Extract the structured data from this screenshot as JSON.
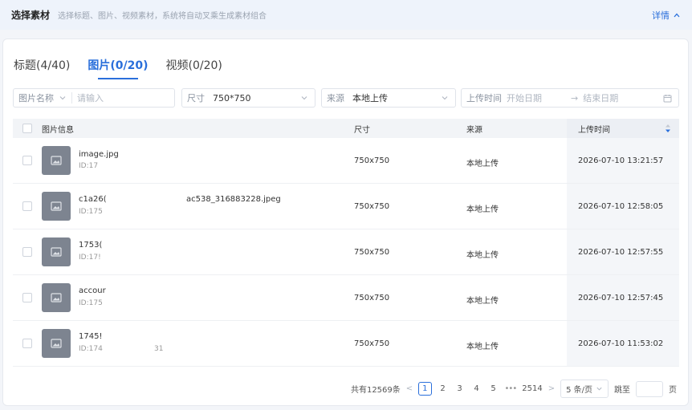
{
  "header": {
    "title": "选择素材",
    "description": "选择标题、图片、视频素材，系统将自动叉乘生成素材组合",
    "details_label": "详情",
    "details_icon": "chevron-up-icon"
  },
  "tabs": [
    {
      "label": "标题(4/40)"
    },
    {
      "label": "图片(0/20)"
    },
    {
      "label": "视频(0/20)"
    }
  ],
  "filters": {
    "name_select": "图片名称",
    "name_placeholder": "请输入",
    "size_label": "尺寸",
    "size_value": "750*750",
    "source_label": "来源",
    "source_value": "本地上传",
    "upload_time_label": "上传时间",
    "start_placeholder": "开始日期",
    "range_arrow": "→",
    "end_placeholder": "结束日期"
  },
  "table": {
    "columns": [
      "图片信息",
      "尺寸",
      "来源",
      "上传时间"
    ],
    "rows": [
      {
        "name": "image.jpg",
        "id": "ID:17",
        "size": "750x750",
        "source": "本地上传",
        "time": "2026-07-10 13:21:57"
      },
      {
        "name": "c1a26(",
        "name_tail": "ac538_316883228.jpeg",
        "id": "ID:175",
        "size": "750x750",
        "source": "本地上传",
        "time": "2026-07-10 12:58:05"
      },
      {
        "name": "1753(",
        "id": "ID:17!",
        "size": "750x750",
        "source": "本地上传",
        "time": "2026-07-10 12:57:55"
      },
      {
        "name": "accour",
        "id": "ID:175",
        "size": "750x750",
        "source": "本地上传",
        "time": "2026-07-10 12:57:45"
      },
      {
        "name": "1745!",
        "id": "ID:174",
        "id_tail": "31",
        "size": "750x750",
        "source": "本地上传",
        "time": "2026-07-10 11:53:02"
      }
    ]
  },
  "pagination": {
    "total": "共有12569条",
    "prev": "<",
    "pages": [
      "1",
      "2",
      "3",
      "4",
      "5"
    ],
    "ellipsis": "•••",
    "last_page": "2514",
    "next": ">",
    "page_size": "5 条/页",
    "goto_label": "跳至",
    "page_unit": "页"
  },
  "colors": {
    "accent": "#2a6fdb",
    "thumb": "#7d8490"
  }
}
